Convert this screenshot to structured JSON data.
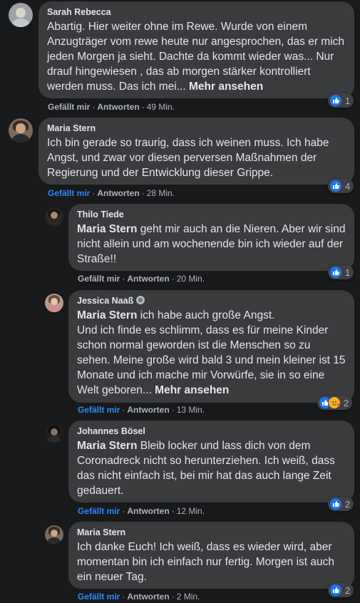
{
  "comments": [
    {
      "author": "Sarah Rebecca",
      "text": "Abartig. Hier weiter ohne im Rewe. Wurde von einem Anzugträger vom rewe heute nur angesprochen, das er mich jeden Morgen ja sieht. Dachte da kommt wieder was... Nur drauf hingewiesen , das ab morgen stärker kontrolliert werden muss. Das ich mei...",
      "more": "Mehr ansehen",
      "like_label": "Gefällt mir",
      "reply_label": "Antworten",
      "time": "49 Min.",
      "reaction_count": "1"
    },
    {
      "author": "Maria Stern",
      "text": "Ich bin gerade so traurig, dass ich weinen muss. Ich habe Angst, und zwar vor diesen perversen Maßnahmen der Regierung und der Entwicklung dieser Grippe.",
      "like_label": "Gefällt mir",
      "reply_label": "Antworten",
      "time": "28 Min.",
      "reaction_count": "4"
    }
  ],
  "replies": [
    {
      "author": "Thilo Tiede",
      "mention": "Maria Stern",
      "text": " geht mir auch an die Nieren. Aber wir sind nicht allein und am wochenende bin ich wieder auf der Straße!!",
      "like_label": "Gefällt mir",
      "reply_label": "Antworten",
      "time": "20 Min.",
      "reaction_count": "1"
    },
    {
      "author": "Jessica Naaß",
      "mention": "Maria Stern",
      "text_1": " ich habe auch große Angst.",
      "text_2": "Und ich finde es schlimm, dass es für meine Kinder schon normal geworden ist die Menschen so zu sehen. Meine große wird bald 3 und mein kleiner ist 15 Monate und ich mache mir Vorwürfe, sie in so eine Welt geboren...",
      "more": "Mehr ansehen",
      "like_label": "Gefällt mir",
      "reply_label": "Antworten",
      "time": "13 Min.",
      "reaction_count": "2"
    },
    {
      "author": "Johannes Bösel",
      "mention": "Maria Stern",
      "text": " Bleib locker und lass dich von dem Coronadreck nicht so herunterziehen. Ich weiß, dass das nicht einfach ist, bei mir hat das auch lange Zeit gedauert.",
      "like_label": "Gefällt mir",
      "reply_label": "Antworten",
      "time": "12 Min.",
      "reaction_count": "2"
    },
    {
      "author": "Maria Stern",
      "text": "Ich danke Euch! Ich weiß, dass es wieder wird, aber momentan bin ich einfach nur fertig. Morgen ist auch ein neuer Tag.",
      "like_label": "Gefällt mir",
      "reply_label": "Antworten",
      "time": "2 Min.",
      "reaction_count": "2"
    }
  ],
  "separator": "·",
  "colors": {
    "background": "#18191a",
    "bubble": "#3a3b3c",
    "text": "#e4e6eb",
    "secondary": "#b0b3b8",
    "liked": "#2d88ff",
    "like_reaction": "#1877f2"
  }
}
